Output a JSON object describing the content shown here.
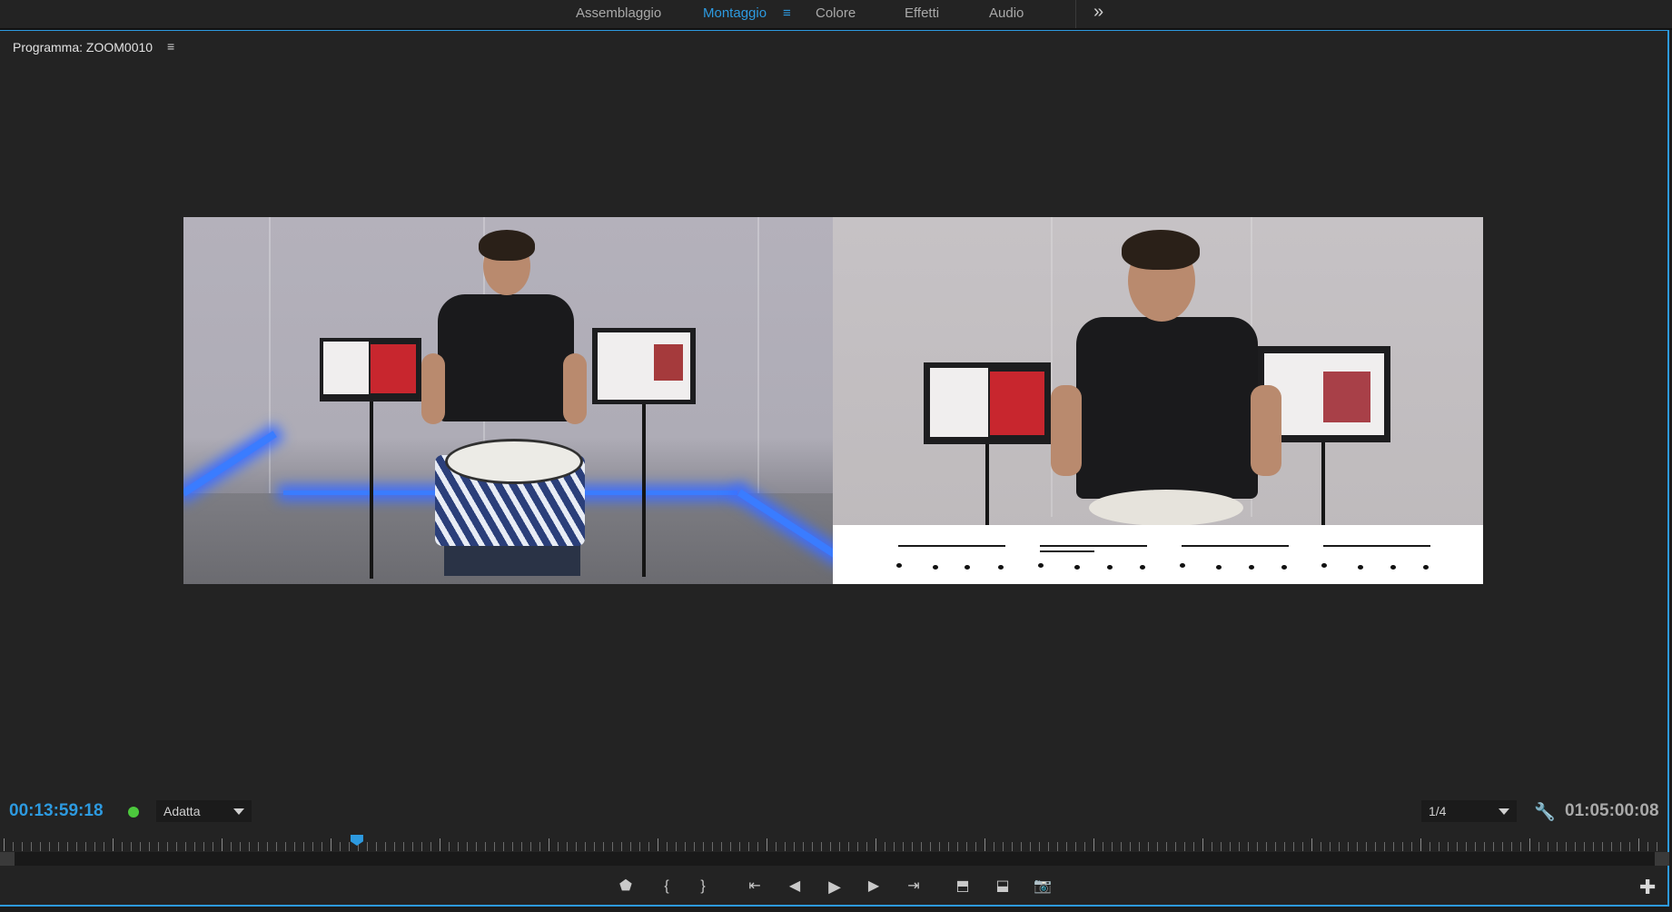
{
  "workspace_tabs": [
    {
      "label": "Assemblaggio",
      "active": false
    },
    {
      "label": "Montaggio",
      "active": true
    },
    {
      "label": "Colore",
      "active": false
    },
    {
      "label": "Effetti",
      "active": false
    },
    {
      "label": "Audio",
      "active": false
    }
  ],
  "workspace_menu_icon": "≡",
  "workspace_more_icon": "»",
  "panel": {
    "title": "Programma: ZOOM0010",
    "menu_icon": "≡"
  },
  "controls": {
    "current_timecode": "00:13:59:18",
    "zoom_value": "Adatta",
    "resolution_value": "1/4",
    "duration_timecode": "01:05:00:08",
    "playhead_fraction": 0.213
  },
  "transport_buttons": [
    {
      "name": "add-marker-icon",
      "glyph": "⬟"
    },
    {
      "name": "mark-in-icon",
      "glyph": "{"
    },
    {
      "name": "mark-out-icon",
      "glyph": "}"
    },
    {
      "name": "go-to-in-icon",
      "glyph": "⇤"
    },
    {
      "name": "step-back-icon",
      "glyph": "◀"
    },
    {
      "name": "play-icon",
      "glyph": "▶"
    },
    {
      "name": "step-forward-icon",
      "glyph": "▶"
    },
    {
      "name": "go-to-out-icon",
      "glyph": "⇥"
    },
    {
      "name": "lift-icon",
      "glyph": "⬒"
    },
    {
      "name": "extract-icon",
      "glyph": "⬓"
    },
    {
      "name": "export-frame-icon",
      "glyph": "📷"
    }
  ],
  "colors": {
    "accent": "#2d9ae0",
    "status_green": "#4cc93d",
    "panel_bg": "#232323"
  }
}
